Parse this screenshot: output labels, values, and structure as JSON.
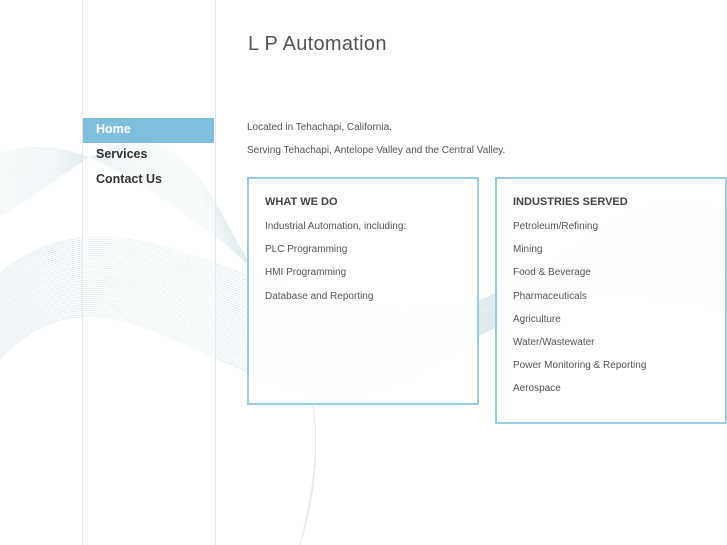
{
  "site": {
    "title": "L P Automation"
  },
  "nav": {
    "items": [
      {
        "label": "Home",
        "active": true
      },
      {
        "label": "Services",
        "active": false
      },
      {
        "label": "Contact Us",
        "active": false
      }
    ]
  },
  "intro": {
    "location": "Located in Tehachapi, California.",
    "serving": "Serving Tehachapi, Antelope Valley and the Central Valley."
  },
  "what_we_do": {
    "heading": "WHAT WE DO",
    "items": [
      "Industrial Automation, including:",
      "PLC Programming",
      "HMI Programming",
      "Database and Reporting"
    ]
  },
  "industries": {
    "heading": "INDUSTRIES SERVED",
    "items": [
      "Petroleum/Refining",
      "Mining",
      "Food & Beverage",
      "Pharmaceuticals",
      "Agriculture",
      "Water/Wastewater",
      "Power Monitoring & Reporting",
      "Aerospace"
    ]
  },
  "colors": {
    "accent": "#7dbfdc",
    "box_border": "#9ccbe0",
    "background_wave": "#b7cdd6"
  }
}
